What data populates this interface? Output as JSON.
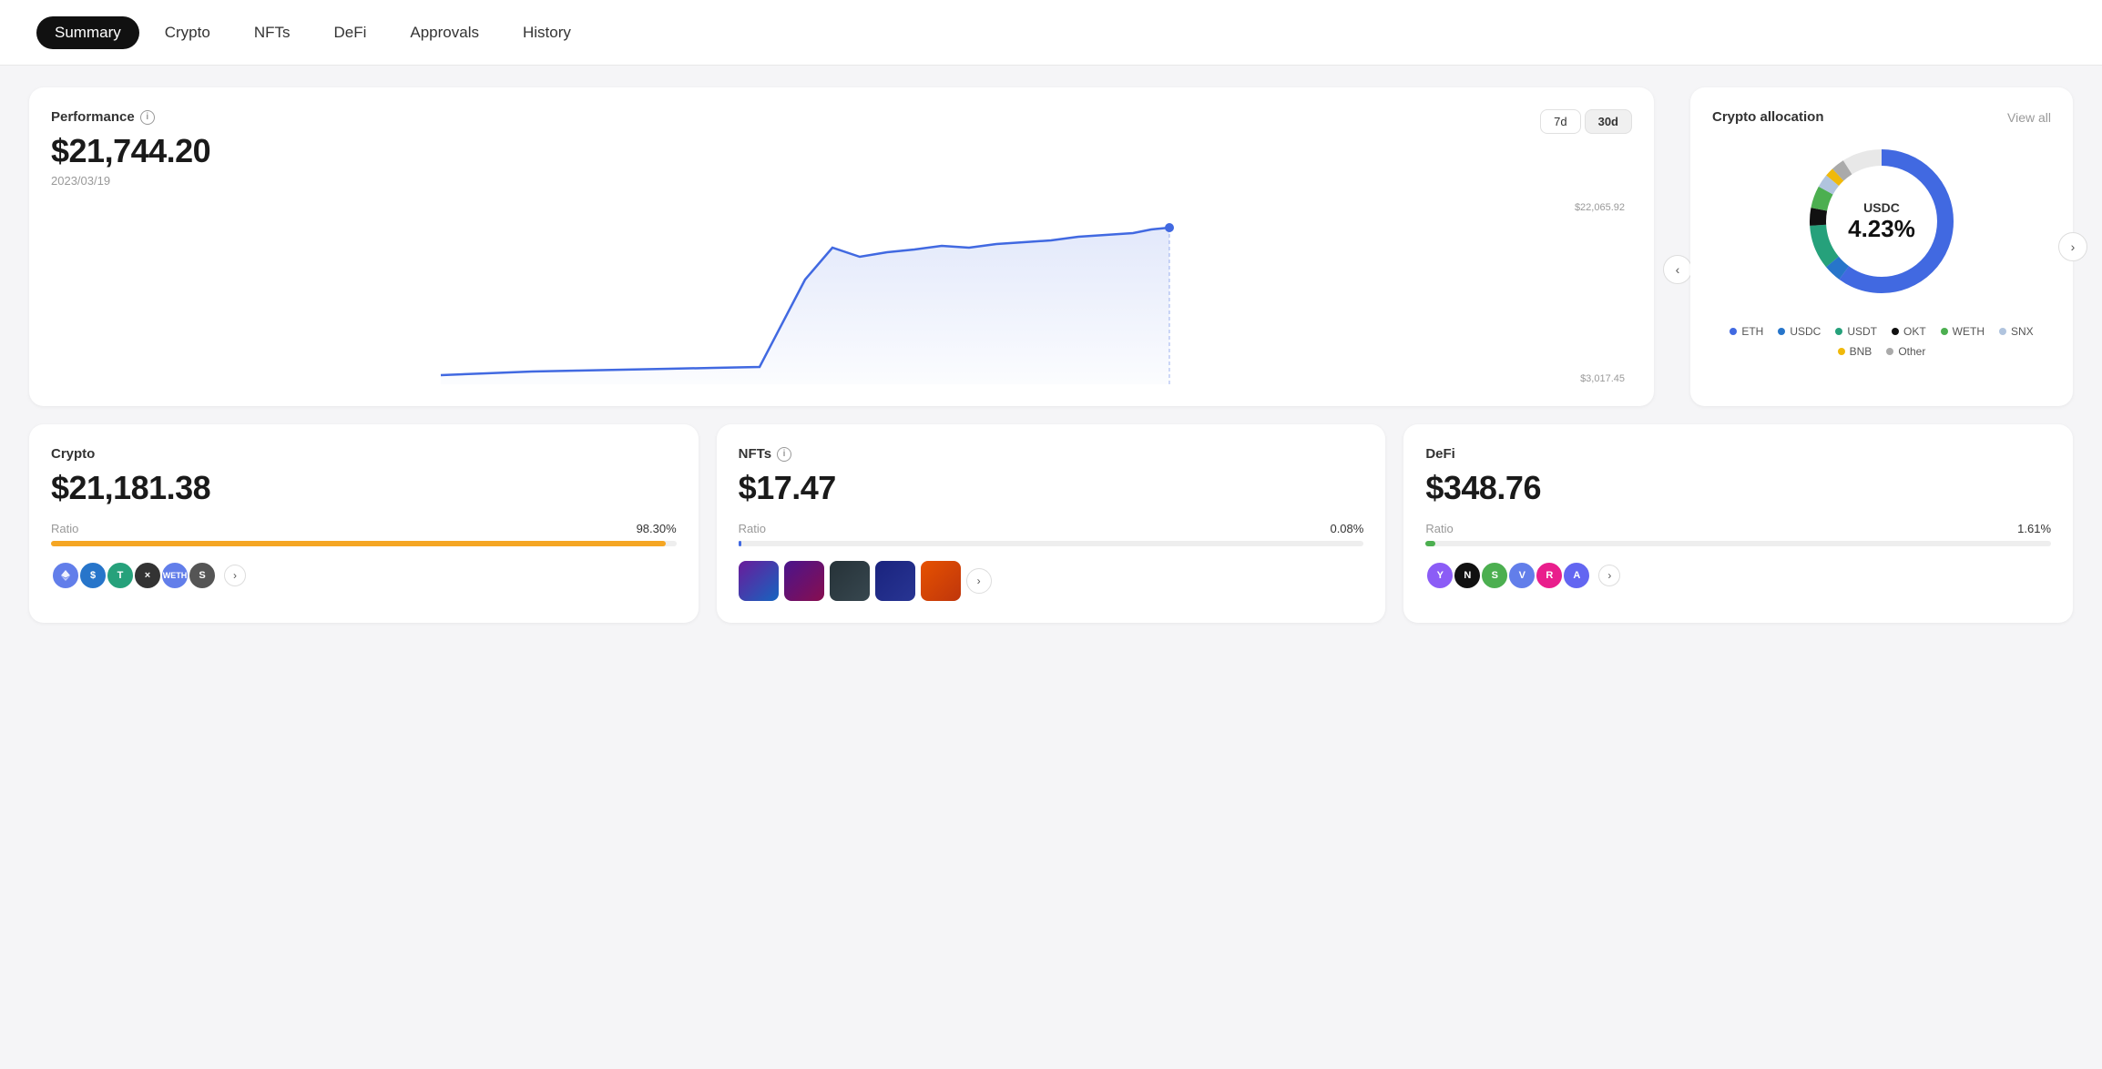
{
  "nav": {
    "items": [
      {
        "label": "Summary",
        "active": true
      },
      {
        "label": "Crypto",
        "active": false
      },
      {
        "label": "NFTs",
        "active": false
      },
      {
        "label": "DeFi",
        "active": false
      },
      {
        "label": "Approvals",
        "active": false
      },
      {
        "label": "History",
        "active": false
      }
    ]
  },
  "performance": {
    "title": "Performance",
    "amount": "$21,744.20",
    "date": "2023/03/19",
    "high_label": "$22,065.92",
    "low_label": "$3,017.45",
    "time_buttons": [
      "7d",
      "30d"
    ],
    "active_time": "30d"
  },
  "allocation": {
    "title": "Crypto allocation",
    "view_all": "View all",
    "center_ticker": "USDC",
    "center_pct": "4.23%",
    "legend": [
      {
        "label": "ETH",
        "color": "#4169e1"
      },
      {
        "label": "USDC",
        "color": "#2775ca"
      },
      {
        "label": "USDT",
        "color": "#26a17b"
      },
      {
        "label": "OKT",
        "color": "#111"
      },
      {
        "label": "WETH",
        "color": "#4caf50"
      },
      {
        "label": "SNX",
        "color": "#b0c4de"
      },
      {
        "label": "BNB",
        "color": "#f0b90b"
      },
      {
        "label": "Other",
        "color": "#aaa"
      }
    ]
  },
  "crypto_card": {
    "title": "Crypto",
    "amount": "$21,181.38",
    "ratio_label": "Ratio",
    "ratio_pct": "98.30%",
    "bar_color": "#f5a623",
    "bar_width": 98.3
  },
  "nfts_card": {
    "title": "NFTs",
    "amount": "$17.47",
    "ratio_label": "Ratio",
    "ratio_pct": "0.08%",
    "bar_color": "#4169e1",
    "bar_width": 0.08
  },
  "defi_card": {
    "title": "DeFi",
    "amount": "$348.76",
    "ratio_label": "Ratio",
    "ratio_pct": "1.61%",
    "bar_color": "#4caf50",
    "bar_width": 1.61
  },
  "tokens": [
    {
      "color": "#627eea",
      "label": "ETH"
    },
    {
      "color": "#2775ca",
      "label": "$"
    },
    {
      "color": "#26a17b",
      "label": "T"
    },
    {
      "color": "#333",
      "label": "×"
    },
    {
      "color": "#627eea",
      "label": "W"
    },
    {
      "color": "#555",
      "label": "S"
    }
  ],
  "defi_tokens": [
    {
      "color": "#8b5cf6",
      "label": "Y"
    },
    {
      "color": "#111",
      "label": "N"
    },
    {
      "color": "#4caf50",
      "label": "S"
    },
    {
      "color": "#627eea",
      "label": "V"
    },
    {
      "color": "#e91e8c",
      "label": "R"
    },
    {
      "color": "#6366f1",
      "label": "A"
    }
  ]
}
